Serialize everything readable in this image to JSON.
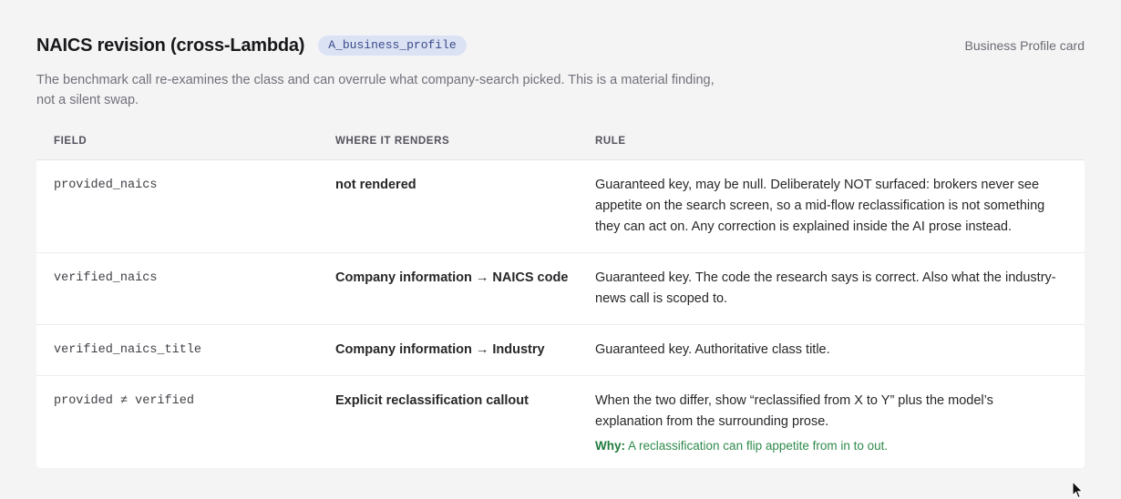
{
  "section": {
    "title": "NAICS revision (cross-Lambda)",
    "tag": "A_business_profile",
    "card_link": "Business Profile card",
    "description": "The benchmark call re-examines the class and can overrule what company-search picked. This is a material finding, not a silent swap."
  },
  "table": {
    "headers": {
      "field": "FIELD",
      "where": "WHERE IT RENDERS",
      "rule": "RULE"
    },
    "rows": [
      {
        "field": "provided_naics",
        "where": "not rendered",
        "rule": "Guaranteed key, may be null. Deliberately NOT surfaced: brokers never see appetite on the search screen, so a mid-flow reclassification is not something they can act on. Any correction is explained inside the AI prose instead."
      },
      {
        "field": "verified_naics",
        "where": "Company information → NAICS code",
        "rule": "Guaranteed key. The code the research says is correct. Also what the industry-news call is scoped to."
      },
      {
        "field": "verified_naics_title",
        "where": "Company information → Industry",
        "rule": "Guaranteed key. Authoritative class title."
      },
      {
        "field": "provided ≠ verified",
        "where": "Explicit reclassification callout",
        "rule": "When the two differ, show “reclassified from X to Y” plus the model’s explanation from the surrounding prose.",
        "why_label": "Why:",
        "why_text": "A reclassification can flip appetite from in to out."
      }
    ]
  }
}
